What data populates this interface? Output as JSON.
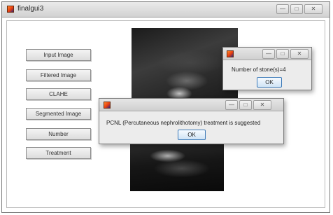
{
  "window": {
    "title": "finalgui3",
    "controls": {
      "minimize": "—",
      "maximize": "□",
      "close": "✕"
    }
  },
  "buttons": [
    {
      "label": "Input Image"
    },
    {
      "label": "Filtered Image"
    },
    {
      "label": "CLAHE"
    },
    {
      "label": "Segmented Image"
    },
    {
      "label": "Number"
    },
    {
      "label": "Treatment"
    }
  ],
  "dialog_stones": {
    "controls": {
      "minimize": "—",
      "maximize": "□",
      "close": "✕"
    },
    "message": "Number of stone(s)=4",
    "ok_label": "OK"
  },
  "dialog_treatment": {
    "controls": {
      "minimize": "—",
      "maximize": "□",
      "close": "✕"
    },
    "message": "PCNL (Percutaneous nephrolithotomy) treatment is suggested",
    "ok_label": "OK"
  },
  "icons": {
    "app": "matlab-icon"
  },
  "colors": {
    "window_bg": "#ffffff",
    "dialog_bg": "#ececec",
    "ok_border": "#3d7ab8"
  }
}
